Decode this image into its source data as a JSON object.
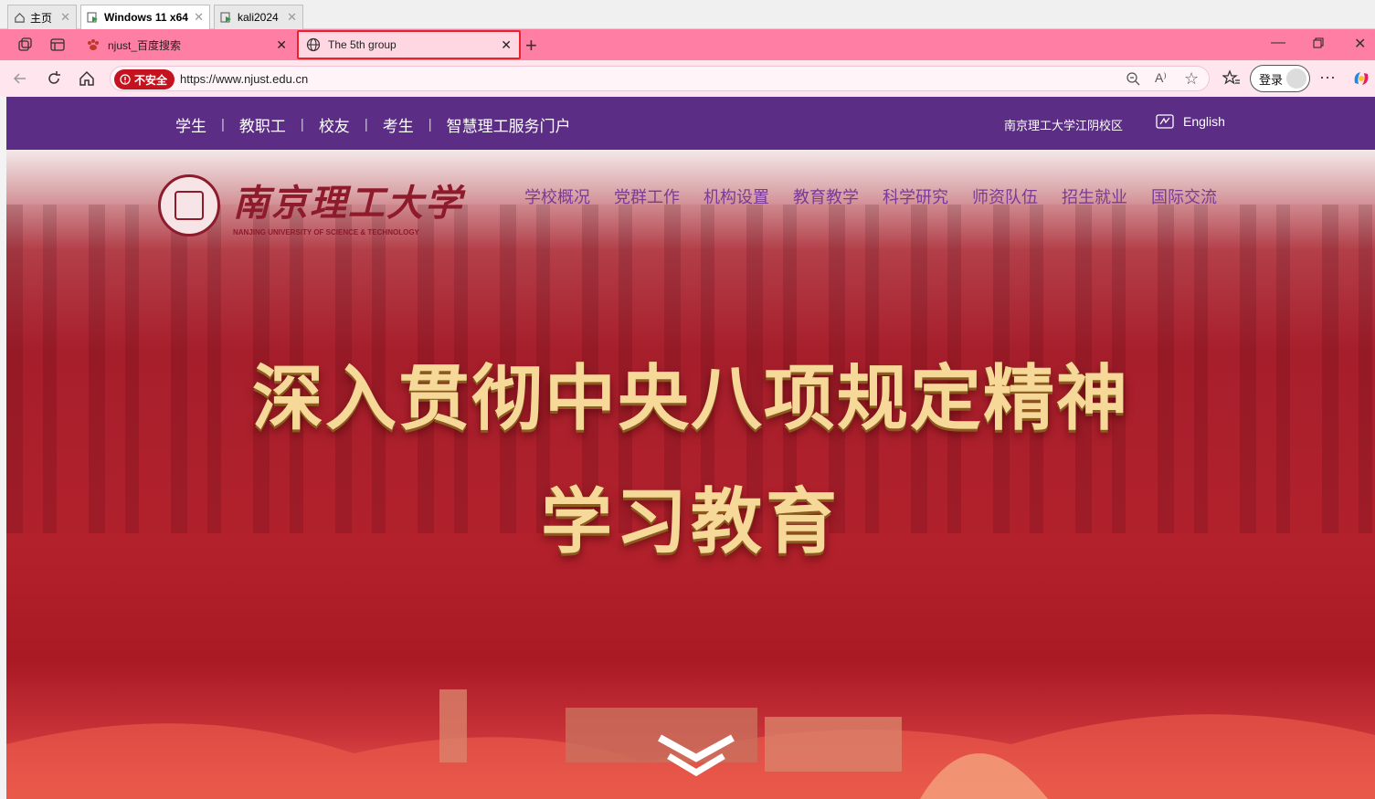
{
  "vm_tabs": [
    {
      "label": "主页",
      "icon": "home-icon"
    },
    {
      "label": "Windows 11 x64",
      "icon": "vm-icon",
      "active": true
    },
    {
      "label": "kali2024",
      "icon": "vm-icon"
    }
  ],
  "browser_tabs": [
    {
      "label": "njust_百度搜索",
      "icon": "baidu-paw-icon"
    },
    {
      "label": "The 5th group",
      "icon": "globe-icon",
      "active": true
    }
  ],
  "address": {
    "security_label": "不安全",
    "url": "https://www.njust.edu.cn",
    "signin_label": "登录"
  },
  "site": {
    "top_links": [
      "学生",
      "教职工",
      "校友",
      "考生",
      "智慧理工服务门户"
    ],
    "campus_link": "南京理工大学江阴校区",
    "english_link": "English",
    "logo_cn": "南京理工大学",
    "logo_en": "NANJING UNIVERSITY OF SCIENCE & TECHNOLOGY",
    "main_nav": [
      "学校概况",
      "党群工作",
      "机构设置",
      "教育教学",
      "科学研究",
      "师资队伍",
      "招生就业",
      "国际交流"
    ],
    "headline_1": "深入贯彻中央八项规定精神",
    "headline_2": "学习教育"
  },
  "colors": {
    "tab_strip": "#ff7ea3",
    "site_nav": "#5b2d84",
    "hero_red": "#a81e2b",
    "headline_gold": "#f6d998"
  }
}
